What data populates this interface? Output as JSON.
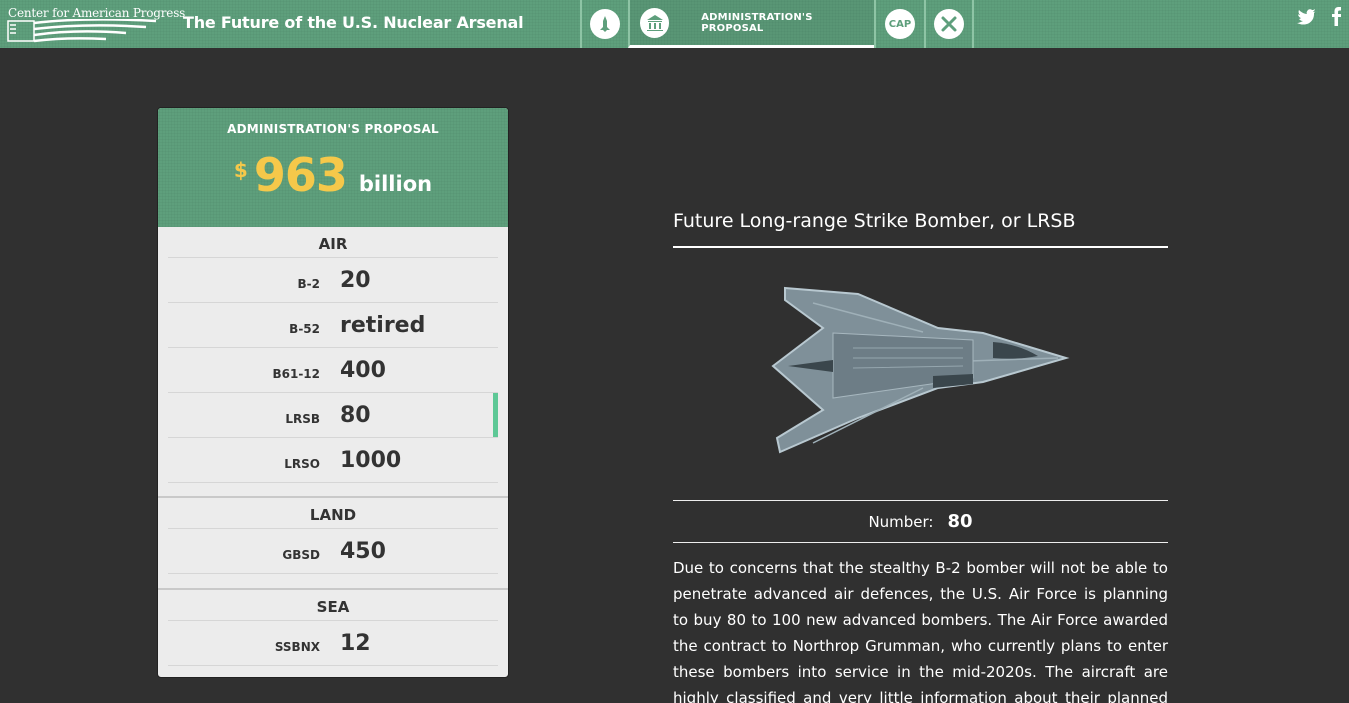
{
  "header": {
    "logo_text": "Center for American Progress",
    "site_title": "The Future of the U.S. Nuclear Arsenal",
    "nav": [
      {
        "icon": "missile-icon"
      },
      {
        "icon": "capitol-building-icon",
        "label": "ADMINISTRATION'S PROPOSAL"
      },
      {
        "icon_text": "CAP"
      },
      {
        "icon": "tools-icon"
      }
    ],
    "social": [
      "twitter-icon",
      "facebook-icon"
    ]
  },
  "card": {
    "title": "ADMINISTRATION'S PROPOSAL",
    "currency": "$",
    "amount": "963",
    "unit": "billion",
    "sections": [
      {
        "name": "AIR",
        "rows": [
          {
            "label": "B-2",
            "value": "20"
          },
          {
            "label": "B-52",
            "value": "retired"
          },
          {
            "label": "B61-12",
            "value": "400"
          },
          {
            "label": "LRSB",
            "value": "80",
            "selected": true
          },
          {
            "label": "LRSO",
            "value": "1000"
          }
        ]
      },
      {
        "name": "LAND",
        "rows": [
          {
            "label": "GBSD",
            "value": "450"
          }
        ]
      },
      {
        "name": "SEA",
        "rows": [
          {
            "label": "SSBNX",
            "value": "12"
          }
        ]
      }
    ]
  },
  "detail": {
    "title": "Future Long-range Strike Bomber, or LRSB",
    "number_label": "Number:",
    "number_value": "80",
    "description": "Due to concerns that the stealthy B-2 bomber will not be able to penetrate advanced air defences, the U.S. Air Force is planning to buy 80 to 100 new advanced bombers. The Air Force awarded the contract to Northrop Grumman, who currently plans to enter these bombers into service in the mid-2020s. The aircraft are highly classified and very little information about their planned capabilities. The Air Force has stated that"
  },
  "colors": {
    "accent": "#5e9f7c",
    "amount": "#f5c84a",
    "selected_indicator": "#5ec896",
    "background": "#303030"
  }
}
